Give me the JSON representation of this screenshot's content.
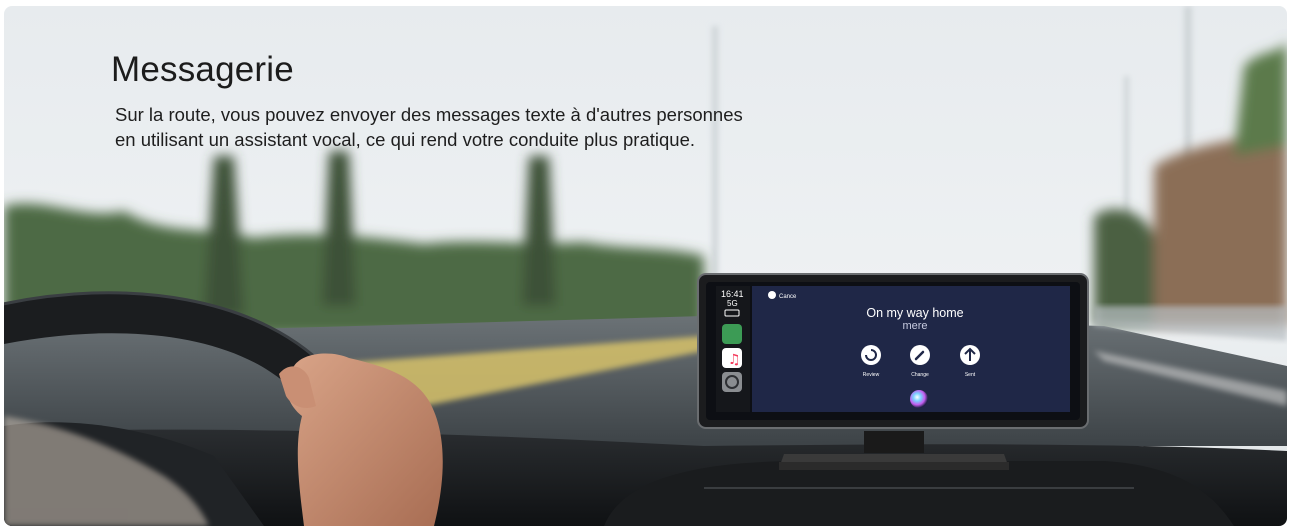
{
  "banner": {
    "title": "Messagerie",
    "description": [
      "Sur la route, vous pouvez envoyer des messages texte à d'autres personnes",
      "en utilisant un assistant vocal, ce qui rend votre conduite plus pratique."
    ]
  },
  "device_screen": {
    "status": {
      "time": "16:41",
      "network": "5G"
    },
    "cancel_label": "Cance",
    "message_text": "On my way home",
    "message_text_partial": "mere",
    "actions": [
      {
        "label": "Review",
        "icon": "replay-icon"
      },
      {
        "label": "Change",
        "icon": "pencil-icon"
      },
      {
        "label": "Sent",
        "icon": "arrow-up-icon"
      }
    ],
    "dock_apps": [
      "maps-icon",
      "music-icon",
      "settings-icon"
    ],
    "voice_assistant_icon": "siri-orb-icon"
  }
}
